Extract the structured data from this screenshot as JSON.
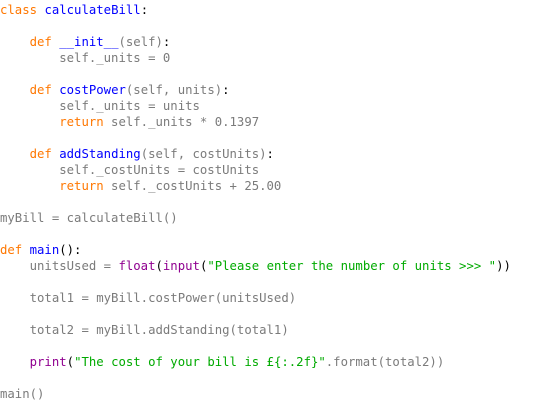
{
  "colors": {
    "keyword": "#ff7700",
    "definition": "#0000ff",
    "string": "#00aa00",
    "builtin": "#900090",
    "faded": "#7b7b7b",
    "text": "#000000",
    "background": "#ffffff"
  },
  "code": {
    "l1": {
      "kw": "class",
      "name": "calculateBill",
      "rest": ":"
    },
    "l2": {
      "indent": "    ",
      "kw": "def",
      "name": "__init__",
      "params": "(self)",
      "rest": ":"
    },
    "l3": {
      "indent": "        ",
      "faded": "self._units = 0"
    },
    "l4": {
      "indent": "    ",
      "kw": "def",
      "name": "costPower",
      "params": "(self, units)",
      "rest": ":"
    },
    "l5": {
      "indent": "        ",
      "faded": "self._units = units"
    },
    "l6": {
      "indent": "        ",
      "kw": "return",
      "faded": " self._units * 0.1397"
    },
    "l7": {
      "indent": "    ",
      "kw": "def",
      "name": "addStanding",
      "params": "(self, costUnits)",
      "rest": ":"
    },
    "l8": {
      "indent": "        ",
      "faded": "self._costUnits = costUnits"
    },
    "l9": {
      "indent": "        ",
      "kw": "return",
      "faded": " self._costUnits + 25.00"
    },
    "l10": {
      "faded": "myBill = calculateBill()"
    },
    "l11": {
      "kw": "def",
      "name": "main",
      "rest": "():"
    },
    "l12": {
      "indent": "    ",
      "faded": "unitsUsed = ",
      "builtin1": "float",
      "p1": "(",
      "builtin2": "input",
      "p2": "(",
      "str": "\"Please enter the number of units >>> \"",
      "p3": "))"
    },
    "l13": {
      "indent": "    ",
      "faded": "total1 = myBill.costPower(unitsUsed)"
    },
    "l14": {
      "indent": "    ",
      "faded": "total2 = myBill.addStanding(total1)"
    },
    "l15": {
      "indent": "    ",
      "builtin": "print",
      "p1": "(",
      "str": "\"The cost of your bill is £{:.2f}\"",
      "faded": ".format(total2))"
    },
    "l16": {
      "faded": "main()"
    }
  }
}
